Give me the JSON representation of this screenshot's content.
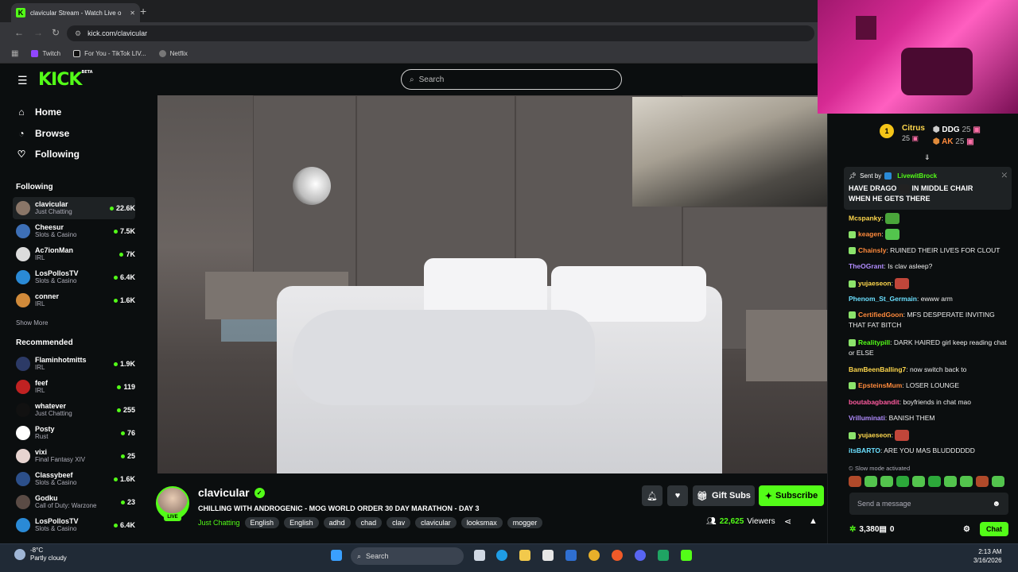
{
  "browser": {
    "tab_title": "clavicular Stream - Watch Live o",
    "url": "kick.com/clavicular",
    "bookmarks": [
      "Twitch",
      "For You - TikTok LIV...",
      "Netflix"
    ]
  },
  "header": {
    "logo": "KICK",
    "logo_sup": "BETA",
    "search_placeholder": "Search"
  },
  "sidebar": {
    "nav": [
      {
        "label": "Home",
        "icon": "home-icon"
      },
      {
        "label": "Browse",
        "icon": "compass-icon"
      },
      {
        "label": "Following",
        "icon": "heart-icon"
      }
    ],
    "following_title": "Following",
    "following": [
      {
        "name": "clavicular",
        "category": "Just Chatting",
        "viewers": "22.6K",
        "color": "#8a7668"
      },
      {
        "name": "Cheesur",
        "category": "Slots & Casino",
        "viewers": "7.5K",
        "color": "#3d6fb6"
      },
      {
        "name": "Ac7ionMan",
        "category": "IRL",
        "viewers": "7K",
        "color": "#dcdcdc"
      },
      {
        "name": "LosPollosTV",
        "category": "Slots & Casino",
        "viewers": "6.4K",
        "color": "#2a8ad6"
      },
      {
        "name": "conner",
        "category": "IRL",
        "viewers": "1.6K",
        "color": "#d08a3a"
      }
    ],
    "show_more": "Show More",
    "recommended_title": "Recommended",
    "recommended": [
      {
        "name": "Flaminhotmitts",
        "category": "IRL",
        "viewers": "1.9K",
        "color": "#2c3a66"
      },
      {
        "name": "feef",
        "category": "IRL",
        "viewers": "119",
        "color": "#c02222"
      },
      {
        "name": "whatever",
        "category": "Just Chatting",
        "viewers": "255",
        "color": "#111111"
      },
      {
        "name": "Posty",
        "category": "Rust",
        "viewers": "76",
        "color": "#ffffff"
      },
      {
        "name": "vixi",
        "category": "Final Fantasy XIV",
        "viewers": "25",
        "color": "#e7d4d0"
      },
      {
        "name": "Classybeef",
        "category": "Slots & Casino",
        "viewers": "1.6K",
        "color": "#2c4f8a"
      },
      {
        "name": "Godku",
        "category": "Call of Duty: Warzone",
        "viewers": "23",
        "color": "#5a4b45"
      },
      {
        "name": "LosPollosTV",
        "category": "Slots & Casino",
        "viewers": "6.4K",
        "color": "#2a8ad6"
      }
    ]
  },
  "stream": {
    "channel": "clavicular",
    "live_label": "LIVE",
    "title": "CHILLING WITH ANDROGENIC - MOG WORLD ORDER 30 DAY MARATHON - DAY 3",
    "category": "Just Chatting",
    "tags": [
      "English",
      "English",
      "adhd",
      "chad",
      "clav",
      "clavicular",
      "looksmax",
      "mogger"
    ],
    "gift_label": "Gift Subs",
    "subscribe_label": "Subscribe",
    "viewers": "22,625",
    "viewers_label": "Viewers"
  },
  "chat": {
    "leaderboard": [
      {
        "rank": "1",
        "name": "Citrus",
        "score": "25"
      },
      {
        "name": "DDG",
        "score": "25"
      },
      {
        "name": "AK",
        "score": "25"
      }
    ],
    "pinned": {
      "sent_by": "Sent by",
      "user": "LivewitBrock",
      "text_a": "HAVE DRAGO",
      "text_b": "IN MIDDLE CHAIR WHEN HE GETS THERE"
    },
    "messages": [
      {
        "user": "Mcspanky",
        "color": "#ffd84d",
        "text": ""
      },
      {
        "user": "keagen",
        "color": "#ff8a3c",
        "text": ""
      },
      {
        "user": "Chainsly",
        "color": "#ff8a3c",
        "text": "RUINED THEIR LIVES FOR CLOUT"
      },
      {
        "user": "TheOGrant",
        "color": "#b18cff",
        "text": "Is clav asleep?"
      },
      {
        "user": "yujaeseon",
        "color": "#ffd84d",
        "text": ""
      },
      {
        "user": "Phenom_St_Germain",
        "color": "#6be0ff",
        "text": "ewww arm"
      },
      {
        "user": "CertifiedGoon",
        "color": "#ff8a3c",
        "text": "MFS DESPERATE INVITING THAT FAT BITCH"
      },
      {
        "user": "Realitypill",
        "color": "#53fc18",
        "text": "DARK HAIRED girl keep reading chat or ELSE"
      },
      {
        "user": "BamBeenBalling7",
        "color": "#ffd84d",
        "text": "now switch back to"
      },
      {
        "user": "EpsteinsMum",
        "color": "#ff8a3c",
        "text": "LOSER LOUNGE"
      },
      {
        "user": "boutabagbandit",
        "color": "#ff5b9f",
        "text": "boyfriends in chat mao"
      },
      {
        "user": "Vrilluminati",
        "color": "#b18cff",
        "text": "BANISH THEM"
      },
      {
        "user": "yujaeseon",
        "color": "#ffd84d",
        "text": ""
      },
      {
        "user": "itsBARTO",
        "color": "#6be0ff",
        "text": "ARE YOU MAS BLUDDDDDD"
      }
    ],
    "slow_mode": "Slow mode activated",
    "placeholder": "Send a message",
    "points": "3,380",
    "gifts": "0",
    "chat_button": "Chat"
  },
  "taskbar": {
    "weather_temp": "-8°C",
    "weather_desc": "Partly cloudy",
    "search": "Search",
    "time": "2:13 AM",
    "date": "3/16/2026"
  },
  "colors": {
    "accent": "#53fc18",
    "bg": "#0b0e0f",
    "panel": "#1e2224"
  }
}
